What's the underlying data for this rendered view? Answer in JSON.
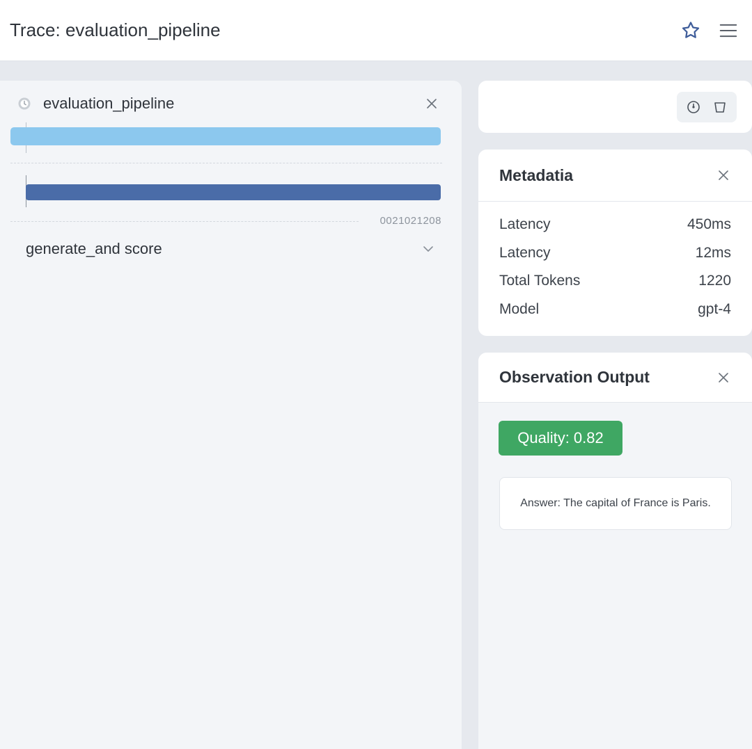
{
  "header": {
    "title": "Trace: evaluation_pipeline",
    "star_icon": "star-icon",
    "menu_icon": "menu-icon"
  },
  "trace": {
    "root": {
      "label": "evaluation_pipeline"
    },
    "bar_time": "0021021208",
    "child": {
      "label": "generate_and score"
    }
  },
  "metadata": {
    "title": "Metadatia",
    "rows": [
      {
        "key": "Latency",
        "value": "450ms"
      },
      {
        "key": "Latency",
        "value": "12ms"
      },
      {
        "key": "Total Tokens",
        "value": "1220"
      },
      {
        "key": "Model",
        "value": "gpt-4"
      }
    ]
  },
  "observation": {
    "title": "Observation Output",
    "badge": "Quality: 0.82",
    "answer": "Answer: The capital of France is Paris."
  },
  "colors": {
    "accent_light": "#8cc8ee",
    "accent_dark": "#4a6ca8",
    "success": "#3fa763"
  }
}
